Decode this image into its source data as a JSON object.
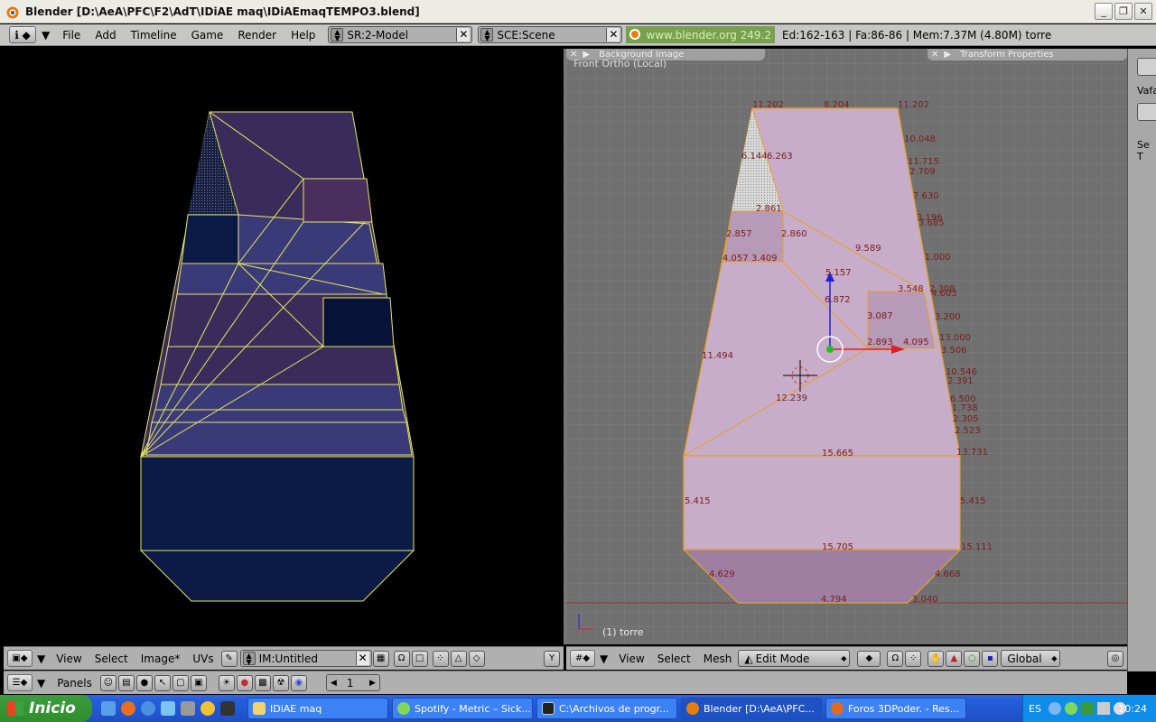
{
  "window": {
    "title": "Blender [D:\\AeA\\PFC\\F2\\AdT\\IDiAE maq\\IDiAEmaqTEMPO3.blend]"
  },
  "menubar": {
    "menus": [
      "File",
      "Add",
      "Timeline",
      "Game",
      "Render",
      "Help"
    ],
    "screen": "SR:2-Model",
    "scene": "SCE:Scene",
    "version": "www.blender.org 249.2",
    "stats": "Ed:162-163 | Fa:86-86 | Mem:7.37M (4.80M) torre"
  },
  "right_view": {
    "panel_bg": "Background Image",
    "panel_tf": "Transform Properties",
    "view_label": "Front Ortho (Local)",
    "object_label": "(1) torre",
    "dimensions": [
      "11.202",
      "8.204",
      "11.202",
      "10.048",
      "11.715",
      "2.709",
      "7.630",
      "3.196",
      "3.685",
      "6.144",
      "6.263",
      "2.861",
      "2.857",
      "2.860",
      "9.589",
      "4.057",
      "3.409",
      "1.000",
      "5.157",
      "3.548",
      "2.308",
      "4.603",
      "6.872",
      "3.087",
      "3.200",
      "2.893",
      "4.095",
      "13.000",
      "3.506",
      "11.494",
      "10.546",
      "2.391",
      "12.239",
      "6.500",
      "1.738",
      "2.305",
      "2.523",
      "13.731",
      "15.665",
      "5.415",
      "5.415",
      "15.705",
      "15.111",
      "4.629",
      "4.668",
      "4.794",
      "3.040"
    ]
  },
  "uv_header": {
    "menus": [
      "View",
      "Select",
      "Image*",
      "UVs"
    ],
    "image_field": "IM:Untitled"
  },
  "view3d_header": {
    "menus": [
      "View",
      "Select",
      "Mesh"
    ],
    "mode": "Edit Mode",
    "orientation": "Global"
  },
  "buttons_header": {
    "label": "Panels",
    "frame": "1"
  },
  "right_strip": {
    "text1": "Vafa",
    "text2": "Se T"
  },
  "taskbar": {
    "start": "Inicio",
    "tasks": [
      {
        "label": "IDiAE maq",
        "color": "#f3d36b"
      },
      {
        "label": "Spotify - Metric – Sick...",
        "color": "#7ed957"
      },
      {
        "label": "C:\\Archivos de progr...",
        "color": "#222222"
      },
      {
        "label": "Blender [D:\\AeA\\PFC...",
        "color": "#e87d0d"
      },
      {
        "label": "Foros 3DPoder. - Res...",
        "color": "#e26b1f"
      }
    ],
    "lang": "ES",
    "clock": "10:24"
  },
  "colors": {
    "uv_face": "#3e2a5e",
    "uv_face_blue": "#1a2a5a",
    "mesh_face": "#c7adc9",
    "mesh_edge": "#e8a020",
    "grid_bg": "#707070",
    "accent_green": "#77a04f"
  }
}
